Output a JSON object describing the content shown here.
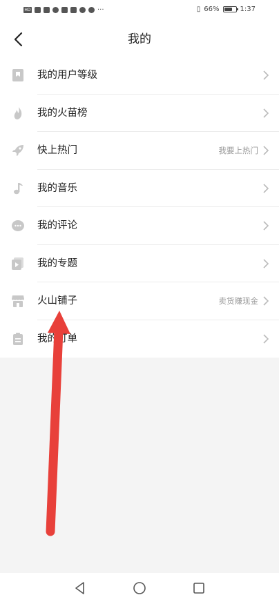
{
  "status_bar": {
    "battery": "66%",
    "time": "1:37",
    "battery_level": 0.66
  },
  "header": {
    "title": "我的"
  },
  "menu": {
    "items": [
      {
        "label": "我的用户等级",
        "hint": "",
        "icon": "bookmark-icon"
      },
      {
        "label": "我的火苗榜",
        "hint": "",
        "icon": "flame-icon"
      },
      {
        "label": "快上热门",
        "hint": "我要上热门",
        "icon": "rocket-icon"
      },
      {
        "label": "我的音乐",
        "hint": "",
        "icon": "music-note-icon"
      },
      {
        "label": "我的评论",
        "hint": "",
        "icon": "comment-icon"
      },
      {
        "label": "我的专题",
        "hint": "",
        "icon": "topic-icon"
      },
      {
        "label": "火山铺子",
        "hint": "卖货赚现金",
        "icon": "shop-icon"
      },
      {
        "label": "我的订单",
        "hint": "",
        "icon": "order-icon"
      }
    ]
  },
  "colors": {
    "annotation_arrow": "#e8403a",
    "icon_gray": "#c8c8c8"
  }
}
